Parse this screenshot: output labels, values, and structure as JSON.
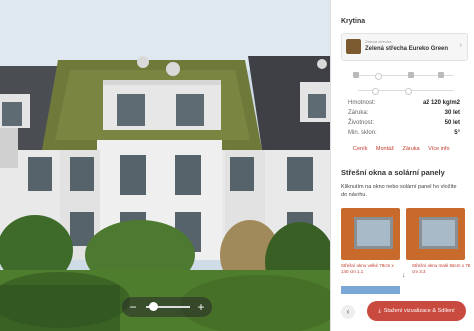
{
  "roof_section": {
    "title": "Krytina",
    "kicker": "Zelená střecha",
    "name": "Zelená střecha Eureko Green"
  },
  "specs": [
    {
      "label": "Hmotnost:",
      "value": "až 120 kg/m2"
    },
    {
      "label": "Záruka:",
      "value": "30 let"
    },
    {
      "label": "Životnost:",
      "value": "50 let"
    },
    {
      "label": "Min. sklon:",
      "value": "5°"
    }
  ],
  "links": [
    "Ceník",
    "Montáž",
    "Záruka",
    "Více info"
  ],
  "windows_section": {
    "title": "Střešní okna a solární panely",
    "description": "Kliknutím na okno nebo solární panel ho vložíte do návrhu.",
    "items": [
      {
        "caption": "Střešní okno velké 78cm x 140 cm 1.1"
      },
      {
        "caption": "Střešní okno malé 55cm x 78 cm 3.3"
      }
    ]
  },
  "download_button": "Stažení vizualizace & Sdílení",
  "zoom": {
    "level": 0.15
  },
  "colors": {
    "accent": "#c94b3f",
    "link": "#c0392b"
  },
  "icons": {
    "zoom_out": "zoom-out-icon",
    "zoom_in": "zoom-in-icon",
    "download": "download-icon",
    "prev": "chevron-left-icon"
  }
}
